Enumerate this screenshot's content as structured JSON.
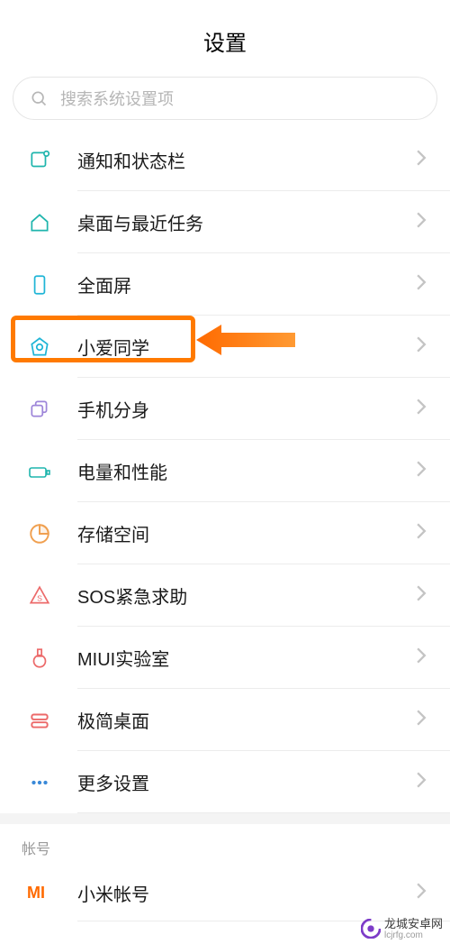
{
  "header": {
    "title": "设置"
  },
  "search": {
    "placeholder": "搜索系统设置项"
  },
  "list": {
    "items": [
      {
        "label": "通知和状态栏",
        "icon": "notification"
      },
      {
        "label": "桌面与最近任务",
        "icon": "home"
      },
      {
        "label": "全面屏",
        "icon": "fullscreen"
      },
      {
        "label": "小爱同学",
        "icon": "xiaoai"
      },
      {
        "label": "手机分身",
        "icon": "clone"
      },
      {
        "label": "电量和性能",
        "icon": "battery"
      },
      {
        "label": "存储空间",
        "icon": "storage"
      },
      {
        "label": "SOS紧急求助",
        "icon": "sos"
      },
      {
        "label": "MIUI实验室",
        "icon": "lab"
      },
      {
        "label": "极简桌面",
        "icon": "simple"
      },
      {
        "label": "更多设置",
        "icon": "more"
      }
    ]
  },
  "account": {
    "section_label": "帐号",
    "mi_account_label": "小米帐号"
  },
  "highlight": {
    "target_index": 3
  },
  "watermark": {
    "brand": "龙城安卓网",
    "url": "lcjrfg.com"
  },
  "colors": {
    "accent_orange": "#ff7a00",
    "teal": "#1fb5ad",
    "cyan": "#1fb5d6",
    "red": "#ec6a6a",
    "violet": "#9d85d9",
    "blue": "#3a89d8"
  }
}
